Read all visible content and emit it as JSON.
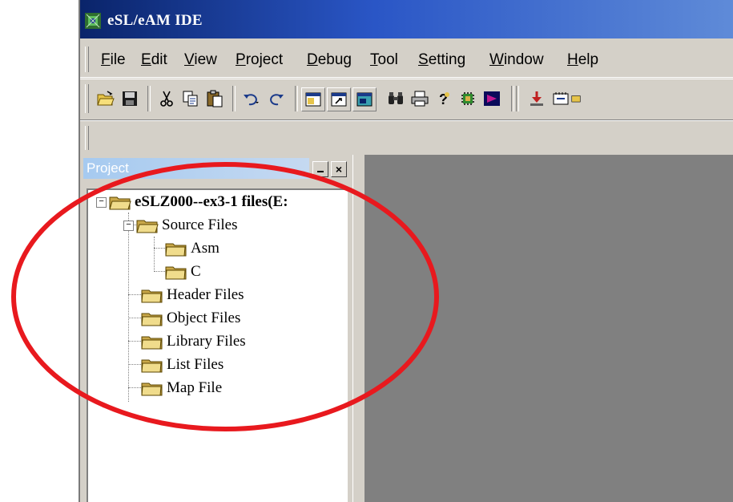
{
  "window": {
    "title": "eSL/eAM IDE",
    "icon": "app-chip-icon"
  },
  "menu": {
    "items": [
      {
        "label_ul": "F",
        "label_rest": "ile"
      },
      {
        "label_ul": "E",
        "label_rest": "dit"
      },
      {
        "label_ul": "V",
        "label_rest": "iew"
      },
      {
        "label_ul": "P",
        "label_rest": "roject"
      },
      {
        "label_ul": "D",
        "label_rest": "ebug"
      },
      {
        "label_ul": "T",
        "label_rest": "ool"
      },
      {
        "label_ul": "S",
        "label_rest": "etting"
      },
      {
        "label_ul": "W",
        "label_rest": "indow"
      },
      {
        "label_ul": "H",
        "label_rest": "elp"
      }
    ]
  },
  "toolbar": {
    "buttons": [
      "open-folder-icon",
      "save-icon",
      "cut-icon",
      "copy-icon",
      "paste-icon",
      "undo-icon",
      "redo-icon",
      "window-icon",
      "find-window-icon",
      "output-window-icon",
      "binoculars-icon",
      "print-icon",
      "help-icon",
      "chip-icon",
      "compile-icon",
      "download-icon",
      "memory-icon"
    ]
  },
  "project_panel": {
    "title": "Project",
    "close_label": "×",
    "tree": {
      "root": "eSLZ000--ex3-1 files(E:",
      "source_files": "Source Files",
      "asm": "Asm",
      "c": "C",
      "header_files": "Header Files",
      "object_files": "Object Files",
      "library_files": "Library Files",
      "list_files": "List Files",
      "map_file": "Map File"
    }
  },
  "colors": {
    "titlebar": "#0a246a",
    "workspace": "#808080",
    "highlight": "#e8191e",
    "folder": "#e8d58a"
  }
}
